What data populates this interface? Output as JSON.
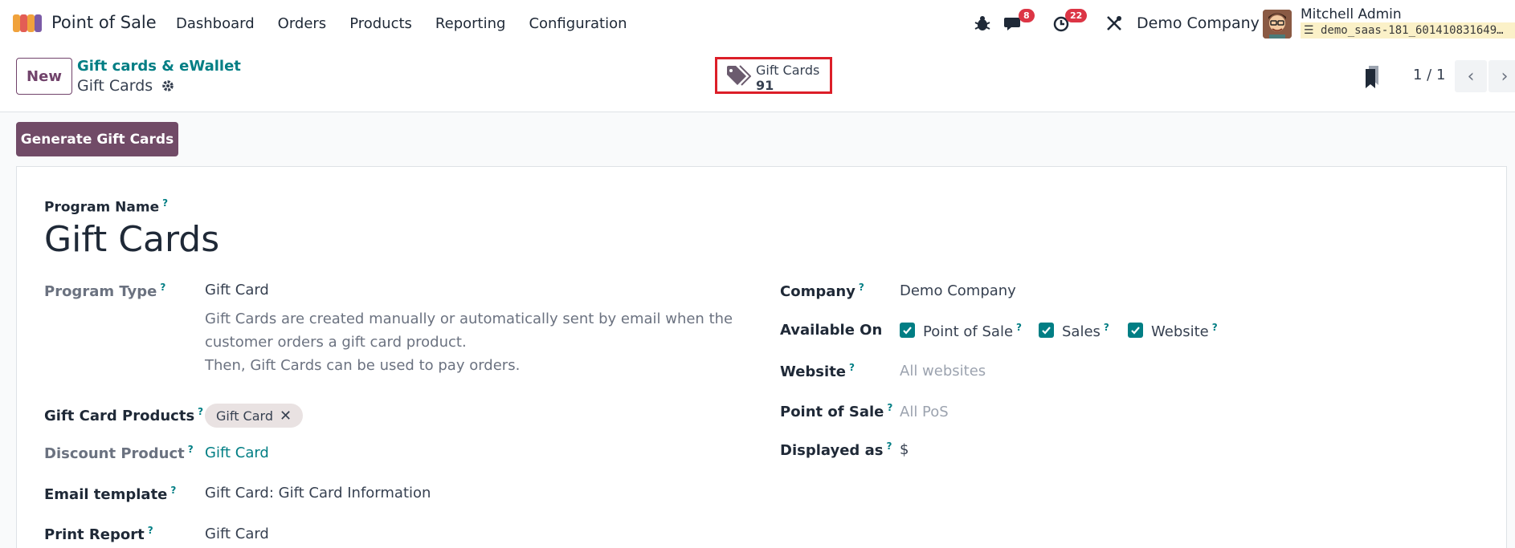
{
  "navbar": {
    "app_name": "Point of Sale",
    "menu": [
      "Dashboard",
      "Orders",
      "Products",
      "Reporting",
      "Configuration"
    ],
    "messages_count": "8",
    "activities_count": "22",
    "company": "Demo Company",
    "user_name": "Mitchell Admin",
    "database": "demo_saas-181_601410831649…"
  },
  "control": {
    "new_label": "New",
    "breadcrumb_parent": "Gift cards & eWallet",
    "breadcrumb_current": "Gift Cards",
    "stat_label": "Gift Cards",
    "stat_value": "91",
    "pager": "1 / 1"
  },
  "generate_label": "Generate Gift Cards",
  "form": {
    "program_name_label": "Program Name",
    "program_name": "Gift Cards",
    "program_type_label": "Program Type",
    "program_type": "Gift Card",
    "description_1": "Gift Cards are created manually or automatically sent by email when the customer orders a gift card product.",
    "description_2": "Then, Gift Cards can be used to pay orders.",
    "gift_card_products_label": "Gift Card Products",
    "gift_card_tag": "Gift Card",
    "discount_product_label": "Discount Product",
    "discount_product": "Gift Card",
    "email_template_label": "Email template",
    "email_template": "Gift Card: Gift Card Information",
    "print_report_label": "Print Report",
    "print_report": "Gift Card",
    "company_label": "Company",
    "company": "Demo Company",
    "available_on_label": "Available On",
    "available_pos": "Point of Sale",
    "available_sales": "Sales",
    "available_website": "Website",
    "website_label": "Website",
    "website": "All websites",
    "pos_label": "Point of Sale",
    "pos": "All PoS",
    "displayed_as_label": "Displayed as",
    "displayed_as": "$",
    "help_mark": "?"
  },
  "colors": {
    "brand": "#714b67",
    "link": "#017e84",
    "badge": "#dc3545",
    "highlight_border": "#dc1e28"
  }
}
